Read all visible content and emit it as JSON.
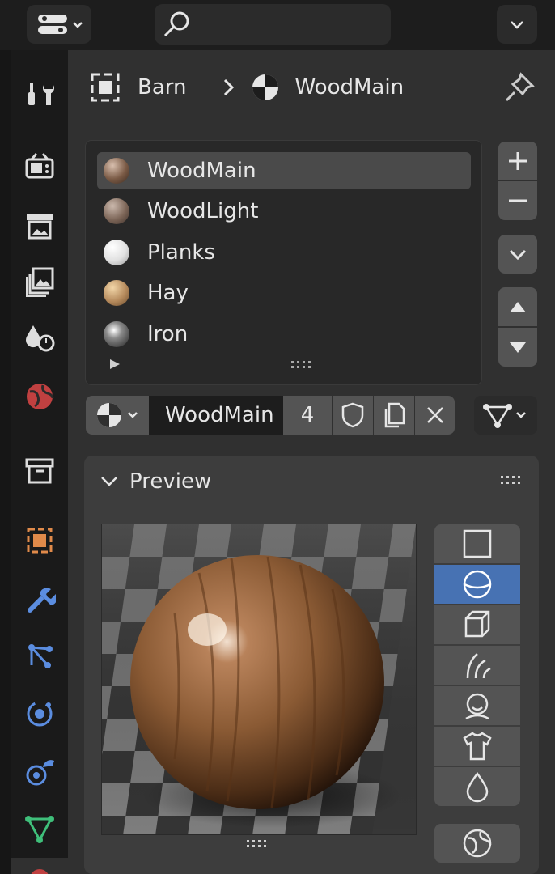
{
  "breadcrumb": {
    "object": "Barn",
    "material": "WoodMain"
  },
  "material_slots": [
    {
      "name": "WoodMain",
      "selected": true,
      "color": "#7a5a45"
    },
    {
      "name": "WoodLight",
      "selected": false,
      "color": "#7d6658"
    },
    {
      "name": "Planks",
      "selected": false,
      "color": "#e6e6e6"
    },
    {
      "name": "Hay",
      "selected": false,
      "color": "#b58a5c"
    },
    {
      "name": "Iron",
      "selected": false,
      "color": "#8a8a8a"
    }
  ],
  "datablock": {
    "name": "WoodMain",
    "users": "4"
  },
  "preview": {
    "title": "Preview"
  },
  "preview_shapes": [
    "flat",
    "sphere",
    "cube",
    "hair",
    "monkey",
    "cloth",
    "fluid"
  ],
  "active_shape": "sphere",
  "colors": {
    "accent": "#4772b3",
    "panel": "#303030",
    "subpanel": "#3d3d3d"
  }
}
